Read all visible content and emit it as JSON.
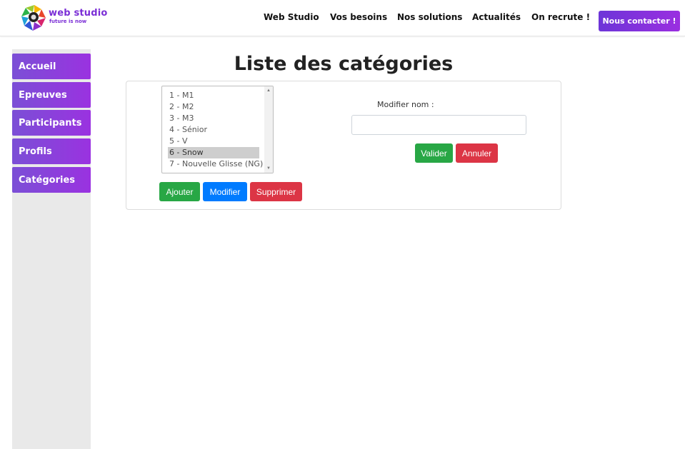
{
  "brand": {
    "name": "web studio",
    "tagline": "future is now"
  },
  "nav": {
    "links": [
      "Web Studio",
      "Vos besoins",
      "Nos solutions",
      "Actualités",
      "On recrute !"
    ],
    "contact_label": "Nous contacter !"
  },
  "sidebar": {
    "items": [
      {
        "label": "Accueil"
      },
      {
        "label": "Epreuves"
      },
      {
        "label": "Participants"
      },
      {
        "label": "Profils"
      },
      {
        "label": "Catégories"
      }
    ]
  },
  "main": {
    "title": "Liste des catégories",
    "categories": [
      "1 - M1",
      "2 - M2",
      "3 - M3",
      "4 - Sénior",
      "5 - V",
      "6 - Snow",
      "7 - Nouvelle Glisse (NG)"
    ],
    "selected_index": 5,
    "buttons": {
      "add": "Ajouter",
      "edit": "Modifier",
      "delete": "Supprimer"
    },
    "edit_form": {
      "label": "Modifier nom :",
      "value": "",
      "placeholder": "",
      "validate": "Valider",
      "cancel": "Annuler"
    }
  },
  "colors": {
    "accent_purple": "#8a3be0",
    "success": "#28a745",
    "primary": "#007bff",
    "danger": "#dc3545"
  }
}
